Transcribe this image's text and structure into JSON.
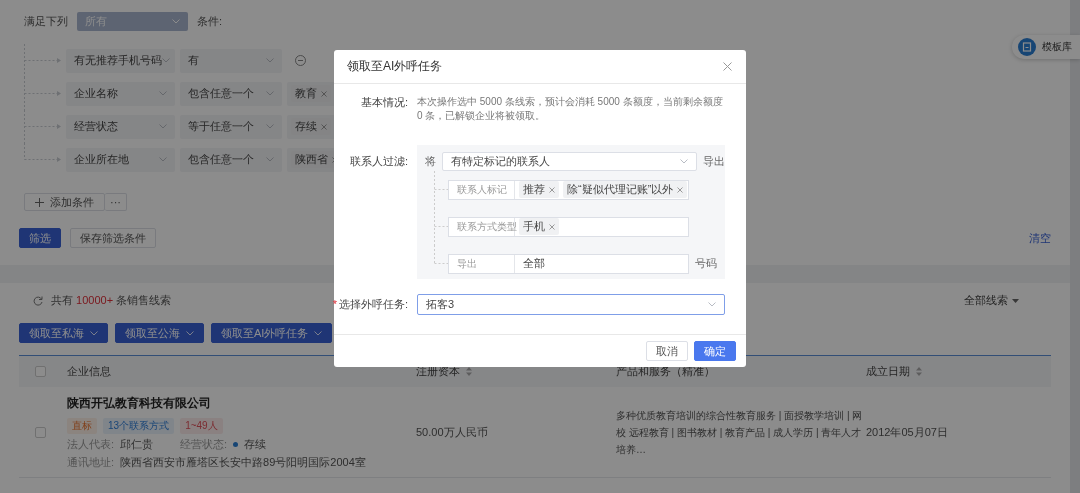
{
  "filter": {
    "match_label": "满足下列",
    "match_value": "所有",
    "condition_label": "条件:",
    "conditions": [
      {
        "field": "有无推荐手机号码",
        "operator": "有",
        "kind": "removable"
      },
      {
        "field": "企业名称",
        "operator": "包含任意一个",
        "kind": "tags",
        "tags": [
          "教育"
        ]
      },
      {
        "field": "经营状态",
        "operator": "等于任意一个",
        "kind": "tags",
        "tags": [
          "存续"
        ]
      },
      {
        "field": "企业所在地",
        "operator": "包含任意一个",
        "kind": "tags",
        "tags": [
          "陕西省"
        ]
      }
    ],
    "add_button": "添加条件",
    "more_button": "···",
    "filter_button": "筛选",
    "save_button": "保存筛选条件",
    "clear_link": "清空"
  },
  "side_tab": {
    "label": "模板库"
  },
  "results": {
    "count_prefix": "共有",
    "count": "10000+",
    "count_suffix": "条销售线索",
    "scope": "全部线索",
    "all_selected": false,
    "actions": [
      "领取至私海",
      "领取至公海",
      "领取至AI外呼任务"
    ],
    "columns": [
      {
        "label": "企业信息",
        "kind": "plain"
      },
      {
        "label": "注册资本",
        "kind": "sortable"
      },
      {
        "label": "产品和服务（精准）",
        "kind": "plain"
      },
      {
        "label": "成立日期",
        "kind": "sortable"
      }
    ],
    "rows": [
      {
        "selected": false,
        "name": "陕西开弘教育科技有限公司",
        "tags": [
          {
            "label": "直标",
            "kind": "source"
          },
          {
            "label": "13个联系方式",
            "kind": "contacts"
          },
          {
            "label": "1~49人",
            "kind": "staff"
          }
        ],
        "legal_label": "法人代表:",
        "legal": "邱仁贵",
        "status_label": "经营状态:",
        "status": "存续",
        "address_label": "通讯地址:",
        "address": "陕西省西安市雁塔区长安中路89号阳明国际2004室",
        "capital": "50.00万人民币",
        "products": "多种优质教育培训的综合性教育服务 | 面授教学培训 | 网校 远程教育 | 图书教材 | 教育产品 | 成人学历 | 青年人才培养…",
        "date": "2012年05月07日"
      }
    ]
  },
  "dialog": {
    "title": "领取至AI外呼任务",
    "summary_label": "基本情况:",
    "summary": "本次操作选中 5000 条线索，预计会消耗 5000 条额度，当前剩余额度 0 条，已解锁企业将被领取。",
    "filter_label": "联系人过滤:",
    "filter_prefix": "将",
    "filter_mode": "有特定标记的联系人",
    "filter_suffix": "导出",
    "sub_filters": [
      {
        "label": "联系人标记",
        "kind": "tags",
        "tags": [
          "推荐",
          "除“疑似代理记账”以外"
        ]
      },
      {
        "label": "联系方式类型",
        "kind": "tags",
        "tags": [
          "手机"
        ]
      },
      {
        "label": "导出",
        "kind": "value",
        "value": "全部",
        "suffix": "号码"
      }
    ],
    "task_label": "选择外呼任务:",
    "task_required_mark": "*",
    "task_value": "拓客3",
    "cancel": "取消",
    "ok": "确定"
  }
}
